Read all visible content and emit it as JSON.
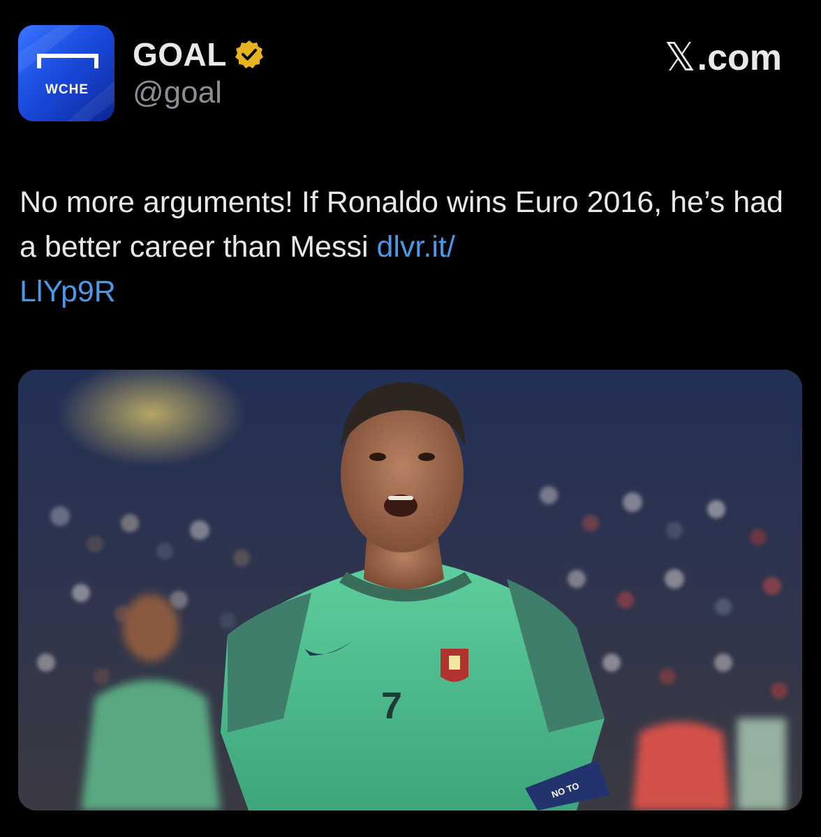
{
  "header": {
    "display_name": "GOAL",
    "handle": "@goal",
    "platform": "X.com",
    "platform_glyph": "𝕏",
    "platform_suffix": ".com",
    "avatar_text": "WCHE",
    "verified_color": "#e8b321"
  },
  "tweet": {
    "text": "No more arguments! If Ronaldo wins Euro 2016, he’s had a better career than Messi ",
    "link_part1": "dlvr.it/",
    "link_part2": "LlYp9R",
    "link_color": "#4a99e9"
  },
  "media": {
    "jersey_number": "7",
    "armband_text": "NO TO"
  },
  "colors": {
    "background": "#000000",
    "text": "#e7e9ea",
    "secondary_text": "#8b8f94"
  }
}
